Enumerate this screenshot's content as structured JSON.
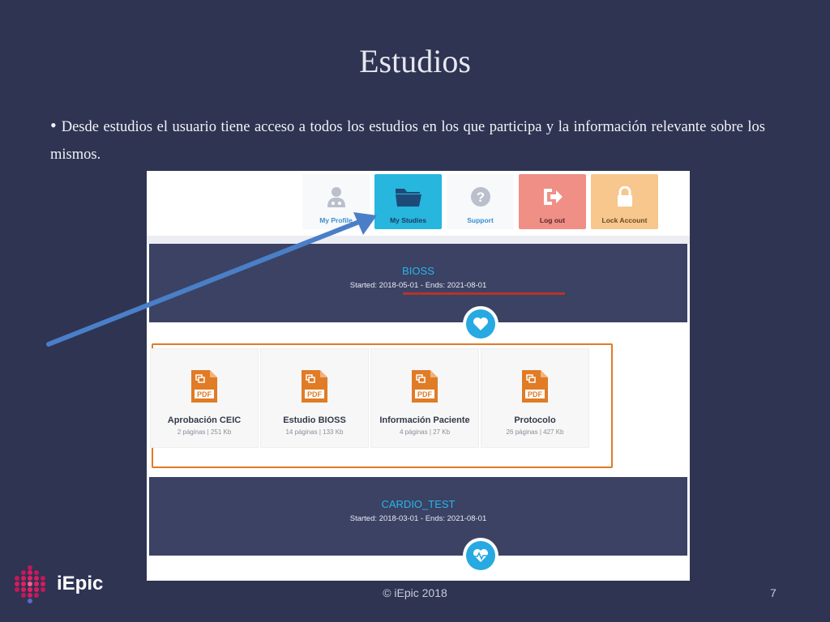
{
  "slide": {
    "title": "Estudios",
    "bullet": "Desde estudios el usuario tiene acceso a todos los estudios en los que participa y la información relevante sobre los mismos.",
    "footer": "© iEpic 2018",
    "page_number": "7",
    "logo_text": "iEpic"
  },
  "nav": {
    "items": [
      {
        "label": "My Profile",
        "icon": "doctor-icon"
      },
      {
        "label": "My Studies",
        "icon": "folder-icon"
      },
      {
        "label": "Support",
        "icon": "question-icon"
      },
      {
        "label": "Log out",
        "icon": "logout-icon"
      },
      {
        "label": "Lock Account",
        "icon": "lock-icon"
      }
    ]
  },
  "studies": [
    {
      "name": "BIOSS",
      "dates": "Started: 2018-05-01 - Ends: 2021-08-01",
      "icon": "heart-icon"
    },
    {
      "name": "CARDIO_TEST",
      "dates": "Started: 2018-03-01 - Ends: 2021-08-01",
      "icon": "heartbeat-icon"
    }
  ],
  "documents": [
    {
      "name": "Aprobación CEIC",
      "info": "2 páginas | 251 Kb"
    },
    {
      "name": "Estudio BIOSS",
      "info": "14 páginas | 133 Kb"
    },
    {
      "name": "Información Paciente",
      "info": "4 páginas | 27 Kb"
    },
    {
      "name": "Protocolo",
      "info": "26 páginas | 427 Kb"
    }
  ],
  "colors": {
    "background": "#2e3452",
    "accent_blue": "#27b6de",
    "pdf_orange": "#e07b26",
    "highlight_frame": "#e07b26",
    "underline_red": "#b5342b",
    "logout": "#ef8f86",
    "lock": "#f7c78e",
    "arrow": "#4a7fc8"
  }
}
